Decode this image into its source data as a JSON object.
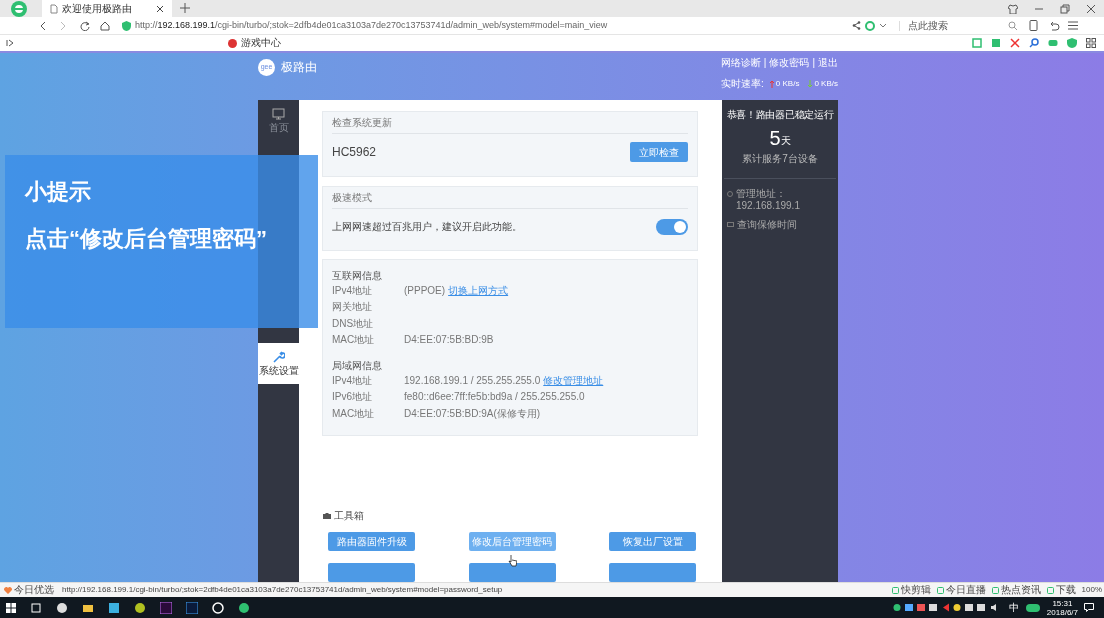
{
  "browser": {
    "tab_title": "欢迎使用极路由",
    "url_prefix": "http://",
    "url_host": "192.168.199.1",
    "url_rest": "/cgi-bin/turbo/;stok=2dfb4de01ca3103a7de270c13753741d/admin_web/system#model=main_view",
    "search_placeholder": "点此搜索",
    "bookmarks": [
      "游戏中心"
    ]
  },
  "router": {
    "brand": "极路由",
    "logo_text": "gee",
    "top_links": [
      "网络诊断",
      "修改密码",
      "退出"
    ],
    "link_separator": "|",
    "speed": {
      "label": "实时速率:",
      "up": "0 KB/s",
      "down": "0 KB/s"
    },
    "sidebar": [
      {
        "label": "首页",
        "selected": false
      },
      {
        "label": "系统设置",
        "selected": true
      }
    ],
    "update_card": {
      "title": "检查系统更新",
      "model": "HC5962",
      "button": "立即检查"
    },
    "turbo_card": {
      "title": "极速模式",
      "text": "上网网速超过百兆用户，建议开启此功能。",
      "on": true
    },
    "info_sections": [
      {
        "title": "互联网信息",
        "rows": [
          {
            "label": "IPv4地址",
            "value": "(PPPOE)",
            "link": "切换上网方式"
          },
          {
            "label": "网关地址"
          },
          {
            "label": "DNS地址"
          },
          {
            "label": "MAC地址",
            "value": "D4:EE:07:5B:BD:9B"
          }
        ]
      },
      {
        "title": "局域网信息",
        "rows": [
          {
            "label": "IPv4地址",
            "value": "192.168.199.1 / 255.255.255.0",
            "link": "修改管理地址"
          },
          {
            "label": "IPv6地址",
            "value": "fe80::d6ee:7ff:fe5b:bd9a / 255.255.255.0"
          },
          {
            "label": "MAC地址",
            "value": "D4:EE:07:5B:BD:9A(保修专用)"
          }
        ]
      }
    ],
    "toolbox": {
      "title": "工具箱",
      "buttons": [
        {
          "label": "路由器固件升级",
          "hover": false
        },
        {
          "label": "修改后台管理密码",
          "hover": true
        },
        {
          "label": "恢复出厂设置",
          "hover": false
        }
      ]
    },
    "status_panel": {
      "title": "恭喜！路由器已稳定运行",
      "days": "5",
      "days_unit": "天",
      "served": "累计服务7台设备",
      "admin": "管理地址：192.168.199.1",
      "warranty": "查询保修时间"
    }
  },
  "tip": {
    "title": "小提示",
    "text": "点击“修改后台管理密码”"
  },
  "status_bar": {
    "left": "今日优选",
    "url": "http://192.168.199.1/cgi-bin/turbo/;stok=2dfb4de01ca3103a7de270c13753741d/admin_web/system#model=password_setup",
    "items": [
      "快剪辑",
      "今日直播",
      "热点资讯",
      "下载"
    ],
    "zoom": "100%"
  },
  "taskbar": {
    "ime": "中",
    "time": "15:31",
    "date": "2018/6/7"
  }
}
